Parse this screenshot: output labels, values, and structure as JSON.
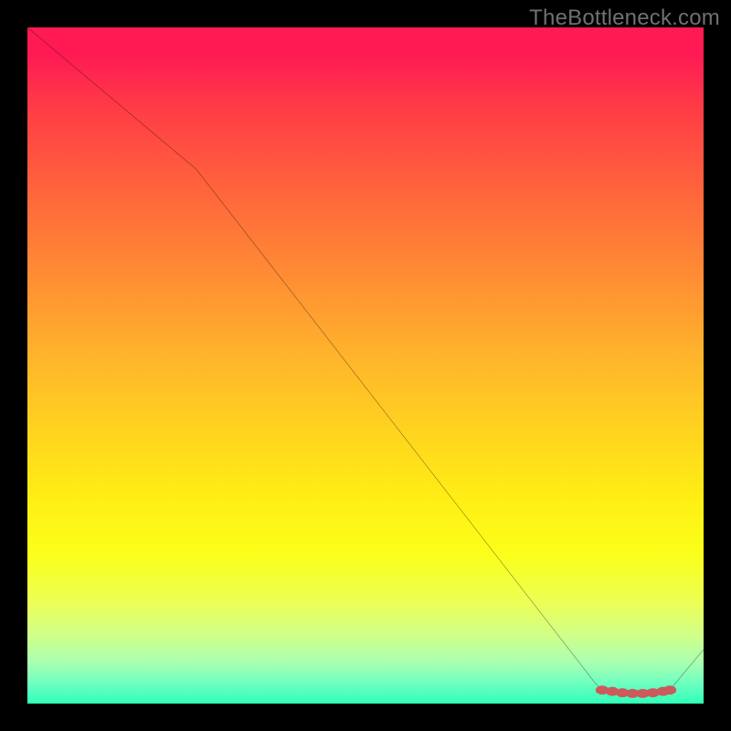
{
  "watermark": "TheBottleneck.com",
  "colors": {
    "page_bg": "#000000",
    "line": "#000000",
    "marker_fill": "#cc5a5d",
    "marker_stroke": "#cc5a5d",
    "gradient_top": "#ff1a54",
    "gradient_bottom": "#2fffb8",
    "watermark_text": "#707070"
  },
  "chart_data": {
    "type": "line",
    "title": "",
    "xlabel": "",
    "ylabel": "",
    "xlim": [
      0,
      100
    ],
    "ylim": [
      0,
      100
    ],
    "grid": false,
    "axes_visible": false,
    "series": [
      {
        "name": "curve",
        "points": [
          {
            "x": 0,
            "y": 100
          },
          {
            "x": 25,
            "y": 79
          },
          {
            "x": 84,
            "y": 3
          },
          {
            "x": 85,
            "y": 2
          },
          {
            "x": 86,
            "y": 1.6
          },
          {
            "x": 88,
            "y": 1.4
          },
          {
            "x": 90,
            "y": 1.3
          },
          {
            "x": 92,
            "y": 1.3
          },
          {
            "x": 94,
            "y": 1.6
          },
          {
            "x": 95,
            "y": 2
          },
          {
            "x": 100,
            "y": 8
          }
        ]
      }
    ],
    "markers": [
      {
        "x": 85,
        "y": 2.0
      },
      {
        "x": 86.5,
        "y": 1.8
      },
      {
        "x": 88,
        "y": 1.6
      },
      {
        "x": 89.5,
        "y": 1.5
      },
      {
        "x": 91,
        "y": 1.5
      },
      {
        "x": 92.5,
        "y": 1.6
      },
      {
        "x": 94,
        "y": 1.8
      },
      {
        "x": 95,
        "y": 2.0
      }
    ]
  }
}
